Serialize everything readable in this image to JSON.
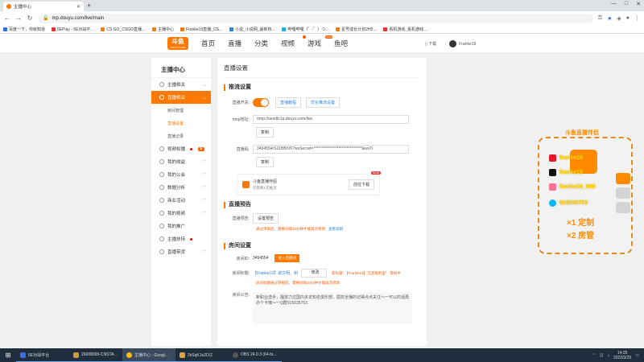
{
  "browser": {
    "tab_title": "主播中心",
    "url": "mp.douyu.com/live/main",
    "bookmarks": [
      "百度一下，你就知道",
      "5EPlay - 5E对战平…",
      "CS:GO_CSGO直播…",
      "主播中心",
      "Franke19直播_CS…",
      "小说_小说网_最新热…",
      "哔哩哔哩（゜-゜）つ…",
      "星号成长计划2H5…",
      "看机游戏_看机游戏…"
    ],
    "bookmark_colors": [
      "#2f6fe4",
      "#e33",
      "#ff7800",
      "#ff7800",
      "#ff7800",
      "#2b84e8",
      "#23ade5",
      "#ff7800",
      "#e33"
    ]
  },
  "site": {
    "logo": "斗鱼",
    "logo_sub": "DOUYU.COM",
    "nav": [
      "首页",
      "直播",
      "分类",
      "视频",
      "游戏",
      "鱼吧"
    ],
    "nav_badges": {
      "video": "",
      "game": "NEW"
    },
    "download": "下载",
    "username": "Franke19"
  },
  "sidebar": {
    "title": "主播中心",
    "items": [
      {
        "label": "主播相关"
      },
      {
        "label": "直播相关"
      },
      {
        "label": "房间管理",
        "sub": true
      },
      {
        "label": "直播设置",
        "sub": true
      },
      {
        "label": "直播记录",
        "sub": true
      },
      {
        "label": "视频松播",
        "tag": "新"
      },
      {
        "label": "我的收益"
      },
      {
        "label": "我的公会"
      },
      {
        "label": "数据分析"
      },
      {
        "label": "商业活动"
      },
      {
        "label": "我的视频"
      },
      {
        "label": "我的推广"
      },
      {
        "label": "主播扶持"
      },
      {
        "label": "直播带货"
      }
    ]
  },
  "main": {
    "title": "直播设置",
    "stream": {
      "section": "推流设置",
      "switch_label": "直播开关:",
      "btn_tutorial": "直播教程",
      "btn_optimize": "优化推流设置",
      "rtmp_label": "rtmp地址:",
      "rtmp_value": "rtmp://sendtc1a.douyu.com/live",
      "copy": "复制",
      "code_label": "直播码:",
      "code_value": "3494554rS21BBIV6?wsSecret=*******************************&wsTi"
    },
    "promo": {
      "title": "斗鱼直播伴侣",
      "desc": "仅需要1次推流",
      "btn": "前往下载",
      "tag": "NEW"
    },
    "preview": {
      "section": "直播预告",
      "label": "直播预告:",
      "btn": "设置预告",
      "note": "通过审核后，需要间隔10分钟才能再次修改",
      "link": "查看说明"
    },
    "room": {
      "section": "房间设置",
      "id_label": "房间ID:",
      "id_value": "3494554",
      "enter_btn": "进入直播间",
      "name_label": "房间标题:",
      "name_value": "【Franke19】讲文明、树新风!",
      "edit_btn": "修改",
      "new_title": "新标题: 【Franke19】沉迷夜色里！ 审核中",
      "name_note": "房间标题通过审核后，需要间隔10分钟才能再次修改",
      "notice_label": "房间公告:",
      "notice_value": "新职业选手，擅技力过国内多支知名俱乐部，屈欢全播的记得点点关注～一可以的话再办个卡噢～一Q群915035753"
    }
  },
  "overlay": {
    "title": "斗鱼直播伴侣",
    "qq": "915035753",
    "line1": "×1 定制",
    "line2": "×2 房管",
    "names": [
      "franke19",
      "franke19",
      "franke19_999"
    ]
  },
  "taskbar": {
    "items": [
      "5E对战平台",
      "26008099-CNSTA…",
      "主播中心 - Googl…",
      "2kSqK1e2D江",
      "OBS 24.0.3 (64-bi…"
    ],
    "time": "14:25",
    "date": "2022/3/25"
  }
}
